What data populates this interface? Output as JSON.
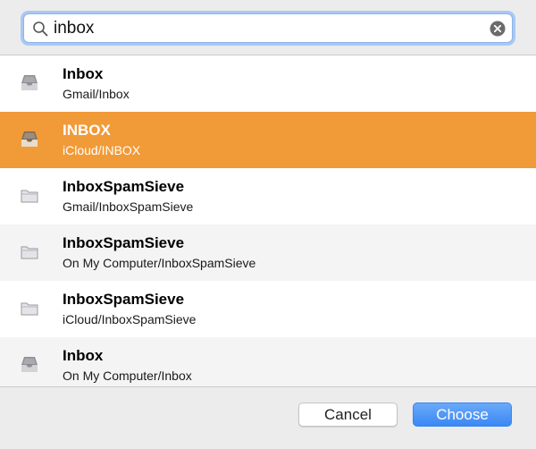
{
  "search": {
    "value": "inbox",
    "icon": "search-icon",
    "clear_icon": "clear-icon"
  },
  "mailboxes": [
    {
      "title": "Inbox",
      "path": "Gmail/Inbox",
      "icon": "inbox-tray-icon",
      "selected": false
    },
    {
      "title": "INBOX",
      "path": "iCloud/INBOX",
      "icon": "inbox-tray-icon",
      "selected": true
    },
    {
      "title": "InboxSpamSieve",
      "path": "Gmail/InboxSpamSieve",
      "icon": "folder-icon",
      "selected": false
    },
    {
      "title": "InboxSpamSieve",
      "path": "On My Computer/InboxSpamSieve",
      "icon": "folder-icon",
      "selected": false
    },
    {
      "title": "InboxSpamSieve",
      "path": "iCloud/InboxSpamSieve",
      "icon": "folder-icon",
      "selected": false
    },
    {
      "title": "Inbox",
      "path": "On My Computer/Inbox",
      "icon": "inbox-tray-icon",
      "selected": false
    }
  ],
  "footer": {
    "cancel_label": "Cancel",
    "choose_label": "Choose"
  },
  "colors": {
    "selection": "#f19a38",
    "alt_row": "#f4f4f4",
    "accent_blue": "#3b88f4",
    "focus_ring": "#a9c8f3"
  }
}
